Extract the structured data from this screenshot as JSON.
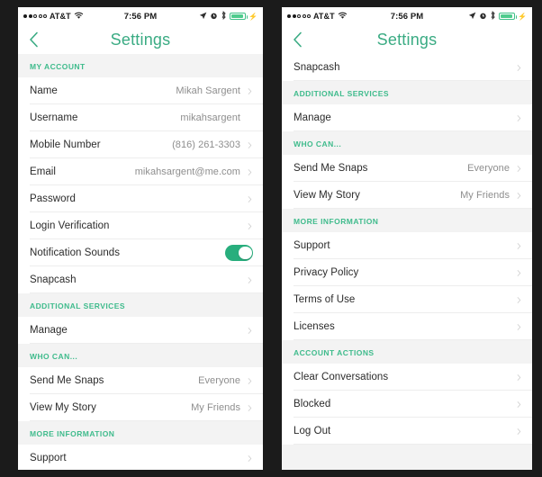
{
  "theme": {
    "accent": "#3fbb8c",
    "title_color": "#3aab83",
    "toggle_on": "#28ae7d",
    "section_bg": "#f3f3f3",
    "row_bg": "#ffffff",
    "backdrop": "#1b1b1b",
    "value_color": "#8e8e8e",
    "label_color": "#2b2b2b"
  },
  "status_bar": {
    "carrier": "AT&T",
    "time": "7:56 PM",
    "signal_dots_filled": 2,
    "signal_dots_empty": 3,
    "icons": [
      "wifi-icon",
      "location-arrow-icon",
      "alarm-clock-icon",
      "bluetooth-icon",
      "battery-icon",
      "charging-bolt-icon"
    ],
    "battery_level_pct": 95
  },
  "nav": {
    "title": "Settings",
    "back_icon": "chevron-left-icon"
  },
  "left_screen": {
    "sections": [
      {
        "header": "MY ACCOUNT",
        "rows": [
          {
            "label": "Name",
            "value": "Mikah Sargent",
            "chevron": true,
            "type": "link"
          },
          {
            "label": "Username",
            "value": "mikahsargent",
            "chevron": false,
            "type": "static"
          },
          {
            "label": "Mobile Number",
            "value": "(816) 261-3303",
            "chevron": true,
            "type": "link"
          },
          {
            "label": "Email",
            "value": "mikahsargent@me.com",
            "chevron": true,
            "type": "link"
          },
          {
            "label": "Password",
            "value": "",
            "chevron": true,
            "type": "link"
          },
          {
            "label": "Login Verification",
            "value": "",
            "chevron": true,
            "type": "link"
          },
          {
            "label": "Notification Sounds",
            "value": "",
            "chevron": false,
            "type": "toggle",
            "toggle_on": true
          },
          {
            "label": "Snapcash",
            "value": "",
            "chevron": true,
            "type": "link"
          }
        ]
      },
      {
        "header": "ADDITIONAL SERVICES",
        "rows": [
          {
            "label": "Manage",
            "value": "",
            "chevron": true,
            "type": "link"
          }
        ]
      },
      {
        "header": "WHO CAN...",
        "rows": [
          {
            "label": "Send Me Snaps",
            "value": "Everyone",
            "chevron": true,
            "type": "link"
          },
          {
            "label": "View My Story",
            "value": "My Friends",
            "chevron": true,
            "type": "link"
          }
        ]
      },
      {
        "header": "MORE INFORMATION",
        "rows": [
          {
            "label": "Support",
            "value": "",
            "chevron": true,
            "type": "link"
          }
        ]
      }
    ]
  },
  "right_screen": {
    "top_rows": [
      {
        "label": "Snapcash",
        "value": "",
        "chevron": true,
        "type": "link"
      }
    ],
    "sections": [
      {
        "header": "ADDITIONAL SERVICES",
        "rows": [
          {
            "label": "Manage",
            "value": "",
            "chevron": true,
            "type": "link"
          }
        ]
      },
      {
        "header": "WHO CAN...",
        "rows": [
          {
            "label": "Send Me Snaps",
            "value": "Everyone",
            "chevron": true,
            "type": "link"
          },
          {
            "label": "View My Story",
            "value": "My Friends",
            "chevron": true,
            "type": "link"
          }
        ]
      },
      {
        "header": "MORE INFORMATION",
        "rows": [
          {
            "label": "Support",
            "value": "",
            "chevron": true,
            "type": "link"
          },
          {
            "label": "Privacy Policy",
            "value": "",
            "chevron": true,
            "type": "link"
          },
          {
            "label": "Terms of Use",
            "value": "",
            "chevron": true,
            "type": "link"
          },
          {
            "label": "Licenses",
            "value": "",
            "chevron": true,
            "type": "link"
          }
        ]
      },
      {
        "header": "ACCOUNT ACTIONS",
        "rows": [
          {
            "label": "Clear Conversations",
            "value": "",
            "chevron": true,
            "type": "link"
          },
          {
            "label": "Blocked",
            "value": "",
            "chevron": true,
            "type": "link"
          },
          {
            "label": "Log Out",
            "value": "",
            "chevron": true,
            "type": "link"
          }
        ]
      }
    ]
  }
}
